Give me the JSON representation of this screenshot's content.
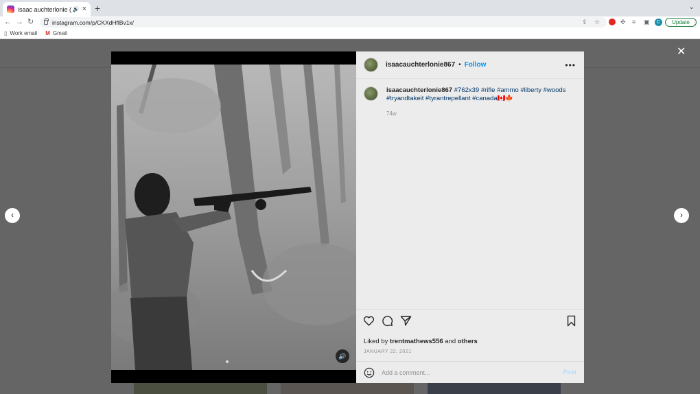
{
  "browser": {
    "tab_title": "isaac auchterlonie (@isaac…",
    "tab_audio_icon": "speaker-icon",
    "url": "instagram.com/p/CKXdHflBv1x/",
    "update_label": "Update",
    "profile_initial": "C",
    "bookmarks": [
      {
        "label": "Work email",
        "icon": "bookmark-icon"
      },
      {
        "label": "Gmail",
        "icon": "gmail-icon"
      }
    ]
  },
  "post": {
    "username": "isaacauchterlonie867",
    "separator": "•",
    "follow_label": "Follow",
    "caption_username": "isaacauchterlonie867",
    "caption_tags": "#762x39 #rifle #ammo #liberty #woods #tryandtakeit #tyrantrepellant #canada🇨🇦🍁",
    "time_ago": "74w",
    "liked_by_prefix": "Liked by",
    "liked_by_user": "trentmathews556",
    "liked_by_and": "and",
    "liked_by_others": "others",
    "date": "JANUARY 22, 2021",
    "comment_placeholder": "Add a comment...",
    "post_label": "Post"
  },
  "colors": {
    "accent": "#0095f6",
    "update_green": "#188038",
    "post_disabled": "#b2dffc"
  }
}
